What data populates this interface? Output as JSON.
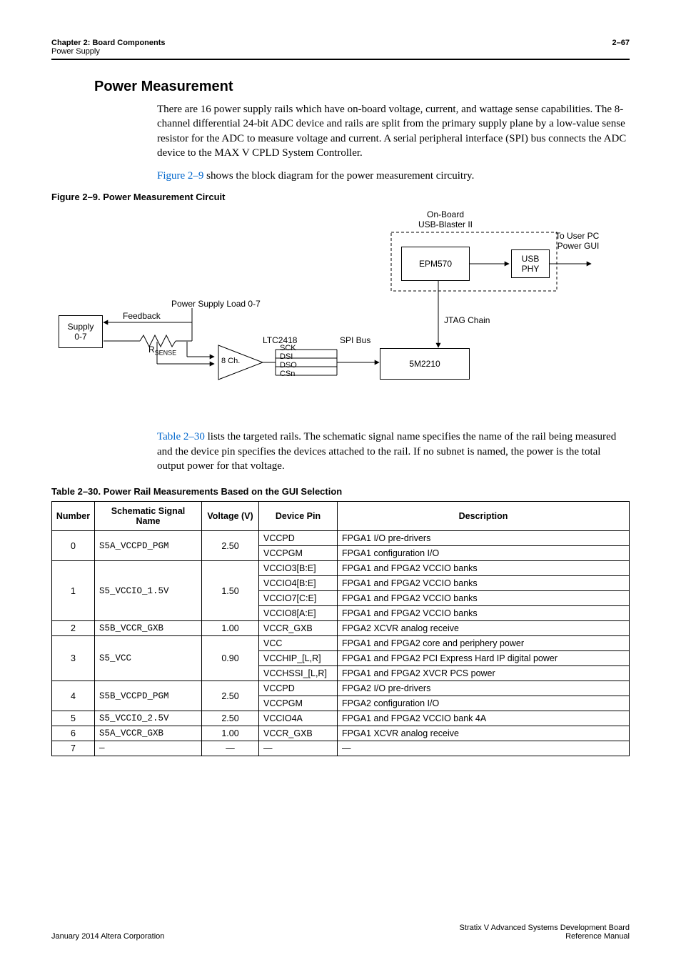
{
  "header": {
    "chapter": "Chapter 2: Board Components",
    "section": "Power Supply",
    "page": "2–67"
  },
  "title": "Power Measurement",
  "para1": "There are 16 power supply rails which have on-board voltage, current, and wattage sense capabilities. The 8-channel differential 24-bit ADC device and rails are split from the primary supply plane by a low-value sense resistor for the ADC to measure voltage and current. A serial peripheral interface (SPI) bus connects the ADC device to the MAX V CPLD System Controller.",
  "para2_pre": "Figure 2–9",
  "para2_post": " shows the block diagram for the power measurement circuitry.",
  "figure_caption": "Figure 2–9.  Power Measurement Circuit",
  "fig": {
    "supply": "Supply\n0-7",
    "feedback": "Feedback",
    "rsense": "R",
    "rsense_sub": "SENSE",
    "load": "Power Supply Load 0-7",
    "ch8": "8 Ch.",
    "ltc": "LTC2418",
    "sck": "SCK",
    "dsi": "DSI",
    "dso": "DSO",
    "csn": "CSn",
    "spi": "SPI Bus",
    "jtag": "JTAG Chain",
    "m2210": "5M2210",
    "epm": "EPM570",
    "usbphy": "USB\nPHY",
    "onboard": "On-Board\nUSB-Blaster II",
    "touser": "To User PC\nPower GUI"
  },
  "para3_pre": "Table 2–30",
  "para3_post": " lists the targeted rails. The schematic signal name specifies the name of the rail being measured and the device pin specifies the devices attached to the rail. If no subnet is named, the power is the total output power for that voltage.",
  "table_caption": "Table 2–30.  Power Rail Measurements Based on the GUI Selection",
  "table": {
    "headers": [
      "Number",
      "Schematic Signal Name",
      "Voltage (V)",
      "Device Pin",
      "Description"
    ],
    "rows": [
      {
        "num": "0",
        "name": "S5A_VCCPD_PGM",
        "volt": "2.50",
        "sub": [
          {
            "pin": "VCCPD",
            "desc": "FPGA1 I/O pre-drivers"
          },
          {
            "pin": "VCCPGM",
            "desc": "FPGA1 configuration I/O"
          }
        ]
      },
      {
        "num": "1",
        "name": "S5_VCCIO_1.5V",
        "volt": "1.50",
        "sub": [
          {
            "pin": "VCCIO3[B:E]",
            "desc": "FPGA1 and FPGA2 VCCIO banks"
          },
          {
            "pin": "VCCIO4[B:E]",
            "desc": "FPGA1 and FPGA2 VCCIO banks"
          },
          {
            "pin": "VCCIO7[C:E]",
            "desc": "FPGA1 and FPGA2 VCCIO banks"
          },
          {
            "pin": "VCCIO8[A:E]",
            "desc": "FPGA1 and FPGA2 VCCIO banks"
          }
        ]
      },
      {
        "num": "2",
        "name": "S5B_VCCR_GXB",
        "volt": "1.00",
        "sub": [
          {
            "pin": "VCCR_GXB",
            "desc": "FPGA2 XCVR analog receive"
          }
        ]
      },
      {
        "num": "3",
        "name": "S5_VCC",
        "volt": "0.90",
        "sub": [
          {
            "pin": "VCC",
            "desc": "FPGA1 and FPGA2 core and periphery power"
          },
          {
            "pin": "VCCHIP_[L,R]",
            "desc": "FPGA1 and FPGA2 PCI Express Hard IP digital power"
          },
          {
            "pin": "VCCHSSI_[L,R]",
            "desc": "FPGA1 and FPGA2 XVCR PCS power"
          }
        ]
      },
      {
        "num": "4",
        "name": "S5B_VCCPD_PGM",
        "volt": "2.50",
        "sub": [
          {
            "pin": "VCCPD",
            "desc": "FPGA2 I/O pre-drivers"
          },
          {
            "pin": "VCCPGM",
            "desc": "FPGA2 configuration I/O"
          }
        ]
      },
      {
        "num": "5",
        "name": "S5_VCCIO_2.5V",
        "volt": "2.50",
        "sub": [
          {
            "pin": "VCCIO4A",
            "desc": "FPGA1 and FPGA2 VCCIO bank 4A"
          }
        ]
      },
      {
        "num": "6",
        "name": "S5A_VCCR_GXB",
        "volt": "1.00",
        "sub": [
          {
            "pin": "VCCR_GXB",
            "desc": "FPGA1 XCVR analog receive"
          }
        ]
      },
      {
        "num": "7",
        "name": "—",
        "volt": "—",
        "sub": [
          {
            "pin": "—",
            "desc": "—"
          }
        ]
      }
    ]
  },
  "footer": {
    "left": "January 2014   Altera Corporation",
    "right1": "Stratix V Advanced Systems Development Board",
    "right2": "Reference Manual"
  }
}
